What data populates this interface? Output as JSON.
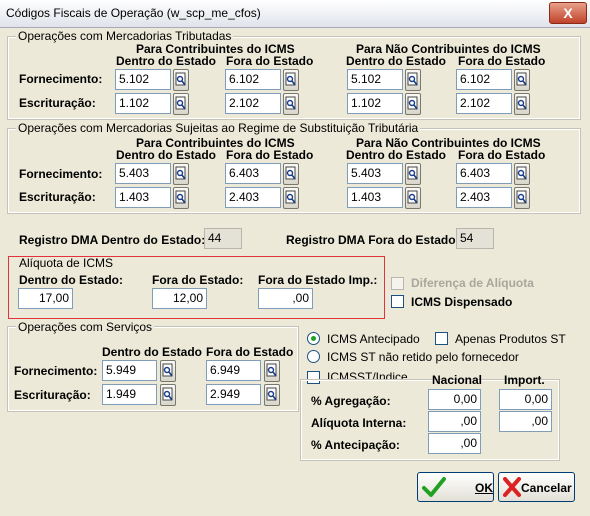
{
  "window": {
    "title": "Códigos Fiscais de Operação (w_scp_me_cfos)",
    "close_glyph": "X"
  },
  "tributadas": {
    "title": "Operações com Mercadorias Tributadas",
    "contrib_header": "Para Contribuintes do ICMS",
    "nao_contrib_header": "Para Não Contribuintes do ICMS",
    "col_dentro": "Dentro do Estado",
    "col_fora": "Fora do Estado",
    "row_fornecimento": "Fornecimento:",
    "row_escrituracao": "Escrituração:",
    "fornecimento": {
      "contrib_dentro": "5.102",
      "contrib_fora": "6.102",
      "nao_dentro": "5.102",
      "nao_fora": "6.102"
    },
    "escrituracao": {
      "contrib_dentro": "1.102",
      "contrib_fora": "2.102",
      "nao_dentro": "1.102",
      "nao_fora": "2.102"
    }
  },
  "st": {
    "title": "Operações com Mercadorias Sujeitas ao Regime de Substituição Tributária",
    "contrib_header": "Para Contribuintes do ICMS",
    "nao_contrib_header": "Para Não Contribuintes do ICMS",
    "col_dentro": "Dentro do Estado",
    "col_fora": "Fora do Estado",
    "row_fornecimento": "Fornecimento:",
    "row_escrituracao": "Escrituração:",
    "fornecimento": {
      "contrib_dentro": "5.403",
      "contrib_fora": "6.403",
      "nao_dentro": "5.403",
      "nao_fora": "6.403"
    },
    "escrituracao": {
      "contrib_dentro": "1.403",
      "contrib_fora": "2.403",
      "nao_dentro": "1.403",
      "nao_fora": "2.403"
    }
  },
  "dma": {
    "dentro_label": "Registro DMA Dentro do Estado:",
    "dentro_value": "44",
    "fora_label": "Registro DMA Fora do Estado:",
    "fora_value": "54"
  },
  "aliquota": {
    "title": "Alíquota de ICMS",
    "dentro_label": "Dentro do Estado:",
    "dentro_value": "17,00",
    "fora_label": "Fora do Estado:",
    "fora_value": "12,00",
    "fora_imp_label": "Fora do Estado Imp.:",
    "fora_imp_value": ",00"
  },
  "diferenca_aliquota_label": "Diferença de Alíquota",
  "icms_dispensado_label": "ICMS Dispensado",
  "servicos": {
    "title": "Operações com Serviços",
    "col_dentro": "Dentro do Estado",
    "col_fora": "Fora do Estado",
    "row_fornecimento": "Fornecimento:",
    "row_escrituracao": "Escrituração:",
    "fornecimento": {
      "dentro": "5.949",
      "fora": "6.949"
    },
    "escrituracao": {
      "dentro": "1.949",
      "fora": "2.949"
    }
  },
  "icms_options": {
    "antecipado": "ICMS Antecipado",
    "apenas_st": "Apenas Produtos ST",
    "st_nao_retido": "ICMS ST não retido pelo fornecedor",
    "icmsst_indice": "ICMSST/Indice",
    "col_nacional": "Nacional",
    "col_import": "Import.",
    "agregacao_label": "% Agregação:",
    "agregacao_nacional": "0,00",
    "agregacao_import": "0,00",
    "aliq_interna_label": "Alíquota Interna:",
    "aliq_interna_nacional": ",00",
    "aliq_interna_import": ",00",
    "antecipacao_label": "% Antecipação:",
    "antecipacao_nacional": ",00"
  },
  "buttons": {
    "ok": "OK",
    "cancelar": "Cancelar"
  },
  "icons": {
    "lookup": "magnifier-page-icon",
    "ok": "green-check-icon",
    "cancel": "red-x-icon"
  }
}
